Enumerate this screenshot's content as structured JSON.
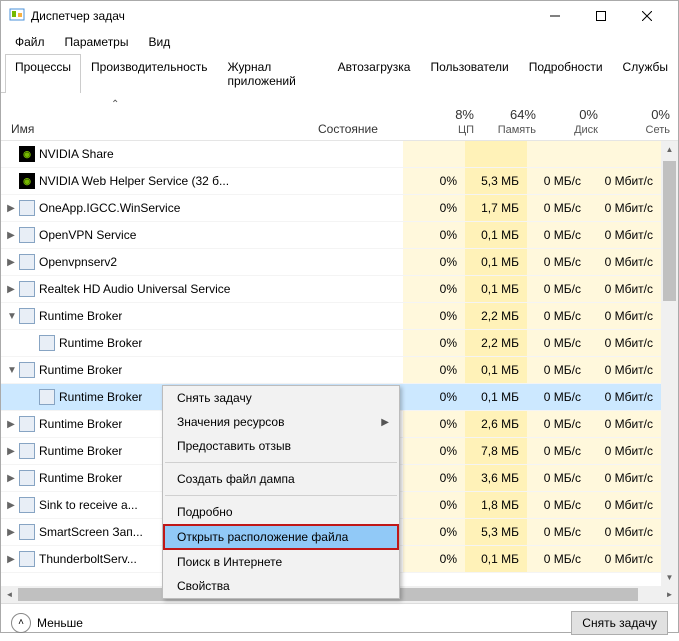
{
  "window": {
    "title": "Диспетчер задач"
  },
  "menus": {
    "file": "Файл",
    "options": "Параметры",
    "view": "Вид"
  },
  "tabs": {
    "processes": "Процессы",
    "performance": "Производительность",
    "apphistory": "Журнал приложений",
    "startup": "Автозагрузка",
    "users": "Пользователи",
    "details": "Подробности",
    "services": "Службы"
  },
  "headers": {
    "name": "Имя",
    "state": "Состояние",
    "cpu_pct": "8%",
    "cpu": "ЦП",
    "mem_pct": "64%",
    "mem": "Память",
    "disk_pct": "0%",
    "disk": "Диск",
    "net_pct": "0%",
    "net": "Сеть"
  },
  "rows": [
    {
      "name": "NVIDIA Share",
      "cpu": "",
      "mem": "",
      "disk": "",
      "net": "",
      "icon": "nvidia"
    },
    {
      "name": "NVIDIA Web Helper Service (32 б...",
      "cpu": "0%",
      "mem": "5,3 МБ",
      "disk": "0 МБ/с",
      "net": "0 Мбит/с",
      "icon": "nvidia"
    },
    {
      "name": "OneApp.IGCC.WinService",
      "cpu": "0%",
      "mem": "1,7 МБ",
      "disk": "0 МБ/с",
      "net": "0 Мбит/с",
      "exp": ">",
      "icon": "gen"
    },
    {
      "name": "OpenVPN Service",
      "cpu": "0%",
      "mem": "0,1 МБ",
      "disk": "0 МБ/с",
      "net": "0 Мбит/с",
      "exp": ">",
      "icon": "gen"
    },
    {
      "name": "Openvpnserv2",
      "cpu": "0%",
      "mem": "0,1 МБ",
      "disk": "0 МБ/с",
      "net": "0 Мбит/с",
      "exp": ">",
      "icon": "gen"
    },
    {
      "name": "Realtek HD Audio Universal Service",
      "cpu": "0%",
      "mem": "0,1 МБ",
      "disk": "0 МБ/с",
      "net": "0 Мбит/с",
      "exp": ">",
      "icon": "gen"
    },
    {
      "name": "Runtime Broker",
      "cpu": "0%",
      "mem": "2,2 МБ",
      "disk": "0 МБ/с",
      "net": "0 Мбит/с",
      "exp": "v",
      "icon": "gen"
    },
    {
      "name": "Runtime Broker",
      "cpu": "0%",
      "mem": "2,2 МБ",
      "disk": "0 МБ/с",
      "net": "0 Мбит/с",
      "indent": true,
      "icon": "gen"
    },
    {
      "name": "Runtime Broker",
      "cpu": "0%",
      "mem": "0,1 МБ",
      "disk": "0 МБ/с",
      "net": "0 Мбит/с",
      "exp": "v",
      "icon": "gen"
    },
    {
      "name": "Runtime Broker",
      "cpu": "0%",
      "mem": "0,1 МБ",
      "disk": "0 МБ/с",
      "net": "0 Мбит/с",
      "indent": true,
      "icon": "gen",
      "selected": true
    },
    {
      "name": "Runtime Broker",
      "cpu": "0%",
      "mem": "2,6 МБ",
      "disk": "0 МБ/с",
      "net": "0 Мбит/с",
      "exp": ">",
      "icon": "gen"
    },
    {
      "name": "Runtime Broker",
      "cpu": "0%",
      "mem": "7,8 МБ",
      "disk": "0 МБ/с",
      "net": "0 Мбит/с",
      "exp": ">",
      "icon": "gen"
    },
    {
      "name": "Runtime Broker",
      "cpu": "0%",
      "mem": "3,6 МБ",
      "disk": "0 МБ/с",
      "net": "0 Мбит/с",
      "exp": ">",
      "icon": "gen"
    },
    {
      "name": "Sink to receive a...",
      "cpu": "0%",
      "mem": "1,8 МБ",
      "disk": "0 МБ/с",
      "net": "0 Мбит/с",
      "exp": ">",
      "icon": "gen"
    },
    {
      "name": "SmartScreen Зап...",
      "cpu": "0%",
      "mem": "5,3 МБ",
      "disk": "0 МБ/с",
      "net": "0 Мбит/с",
      "exp": ">",
      "icon": "gen"
    },
    {
      "name": "ThunderboltServ...",
      "cpu": "0%",
      "mem": "0,1 МБ",
      "disk": "0 МБ/с",
      "net": "0 Мбит/с",
      "exp": ">",
      "icon": "gen"
    }
  ],
  "context_menu": {
    "end_task": "Снять задачу",
    "resource_values": "Значения ресурсов",
    "feedback": "Предоставить отзыв",
    "create_dump": "Создать файл дампа",
    "details": "Подробно",
    "open_location": "Открыть расположение файла",
    "search_online": "Поиск в Интернете",
    "properties": "Свойства"
  },
  "footer": {
    "fewer": "Меньше",
    "end_task": "Снять задачу"
  }
}
